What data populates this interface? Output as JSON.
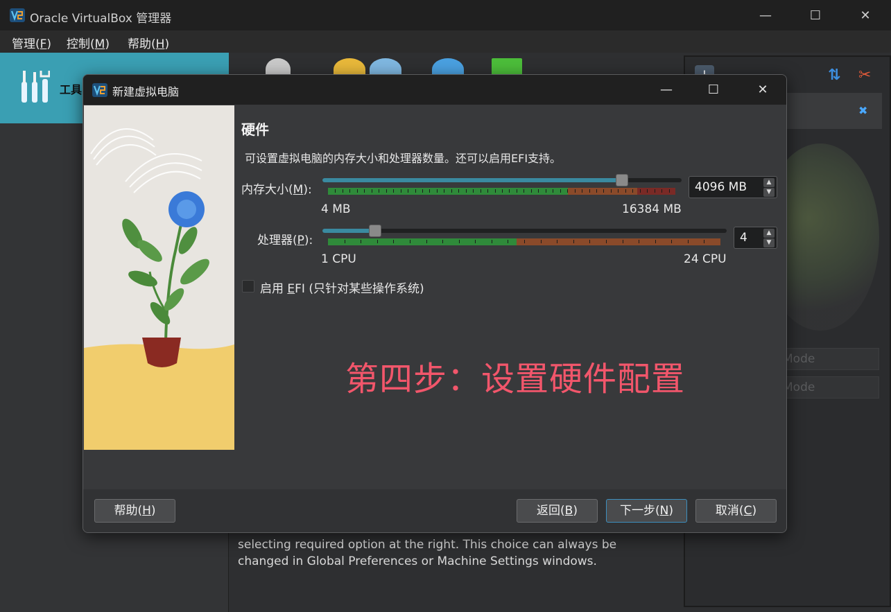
{
  "window": {
    "title": "Oracle VirtualBox 管理器",
    "minimize": "—",
    "maximize": "☐",
    "close": "✕"
  },
  "menu": [
    {
      "label": "管理(",
      "key": "F",
      "end": ")"
    },
    {
      "label": "控制(",
      "key": "M",
      "end": ")"
    },
    {
      "label": "帮助(",
      "key": "H",
      "end": ")"
    }
  ],
  "left_pane": {
    "tools_label": "工具"
  },
  "right_pane": {
    "close_glyph": "✖",
    "sort_glyph": "⇅",
    "info_glyph": "!",
    "tool_glyph": "✂",
    "mode_buttons": [
      "Mode",
      "Mode"
    ]
  },
  "background_text": "selecting required option at the right. This choice can always be changed in Global Preferences or Machine Settings windows.",
  "dialog": {
    "title": "新建虚拟电脑",
    "minimize": "—",
    "maximize": "☐",
    "close": "✕",
    "section_title": "硬件",
    "section_desc": "可设置虚拟电脑的内存大小和处理器数量。还可以启用EFI支持。",
    "memory": {
      "label_pre": "内存大小(",
      "label_key": "M",
      "label_post": "):",
      "value_mb": 4096,
      "value_text": "4096 MB",
      "min_text": "4 MB",
      "max_text": "16384 MB",
      "min": 4,
      "max": 16384,
      "green_fraction": 0.5,
      "orange_fraction": 0.2,
      "red_fraction": 0.12
    },
    "cpu": {
      "label_pre": "处理器(",
      "label_key": "P",
      "label_post": "):",
      "value": 4,
      "value_text": "4",
      "min_text": "1 CPU",
      "max_text": "24 CPU",
      "min": 1,
      "max": 24,
      "green_fraction": 0.48,
      "orange_fraction": 0.52
    },
    "efi": {
      "label_pre": "启用 ",
      "label_key": "E",
      "label_post": "FI (只针对某些操作系统)",
      "checked": false
    },
    "annotation": "第四步：设置硬件配置",
    "buttons": {
      "help": {
        "pre": "帮助(",
        "key": "H",
        "post": ")"
      },
      "back": {
        "pre": "返回(",
        "key": "B",
        "post": ")"
      },
      "next": {
        "pre": "下一步(",
        "key": "N",
        "post": ")"
      },
      "cancel": {
        "pre": "取消(",
        "key": "C",
        "post": ")"
      }
    }
  },
  "colors": {
    "accent": "#3a9fb3",
    "annotation": "#f2566b",
    "scale_green": "#2f8a3a",
    "scale_orange": "#8a4a2a",
    "scale_red": "#7a2a26"
  }
}
